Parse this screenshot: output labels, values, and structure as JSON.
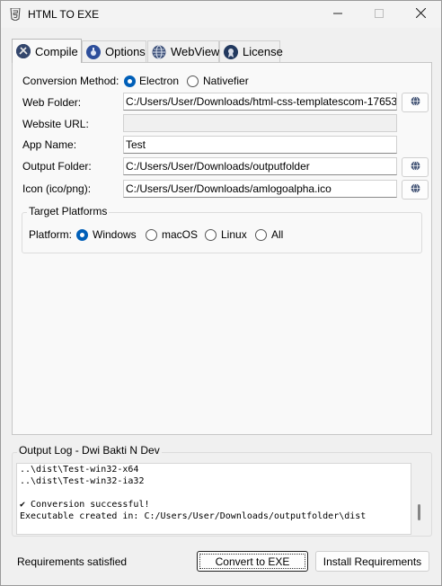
{
  "window": {
    "title": "HTML TO EXE"
  },
  "tabs": [
    {
      "label": "Compile",
      "icon": "compile-icon",
      "selected": true
    },
    {
      "label": "Options",
      "icon": "options-icon",
      "selected": false
    },
    {
      "label": "WebView",
      "icon": "webview-icon",
      "selected": false
    },
    {
      "label": "License",
      "icon": "license-icon",
      "selected": false
    }
  ],
  "compile": {
    "conversion_method_label": "Conversion Method:",
    "methods": [
      {
        "label": "Electron",
        "selected": true
      },
      {
        "label": "Nativefier",
        "selected": false
      }
    ],
    "web_folder_label": "Web Folder:",
    "web_folder_value": "C:/Users/User/Downloads/html-css-templatescom-17653",
    "website_url_label": "Website URL:",
    "website_url_value": "",
    "app_name_label": "App Name:",
    "app_name_value": "Test",
    "output_folder_label": "Output Folder:",
    "output_folder_value": "C:/Users/User/Downloads/outputfolder",
    "icon_label": "Icon (ico/png):",
    "icon_value": "C:/Users/User/Downloads/amlogoalpha.ico",
    "target_platforms_title": "Target Platforms",
    "platform_label": "Platform:",
    "platforms": [
      {
        "label": "Windows",
        "selected": true
      },
      {
        "label": "macOS",
        "selected": false
      },
      {
        "label": "Linux",
        "selected": false
      },
      {
        "label": "All",
        "selected": false
      }
    ]
  },
  "log": {
    "title": "Output Log - Dwi Bakti N Dev",
    "lines": [
      "..\\dist\\Test-win32-x64",
      "..\\dist\\Test-win32-ia32",
      "",
      "✔ Conversion successful!",
      "Executable created in: C:/Users/User/Downloads/outputfolder\\dist"
    ]
  },
  "status_text": "Requirements satisfied",
  "buttons": {
    "convert": "Convert to EXE",
    "install": "Install Requirements"
  },
  "colors": {
    "accent": "#005fb8"
  }
}
